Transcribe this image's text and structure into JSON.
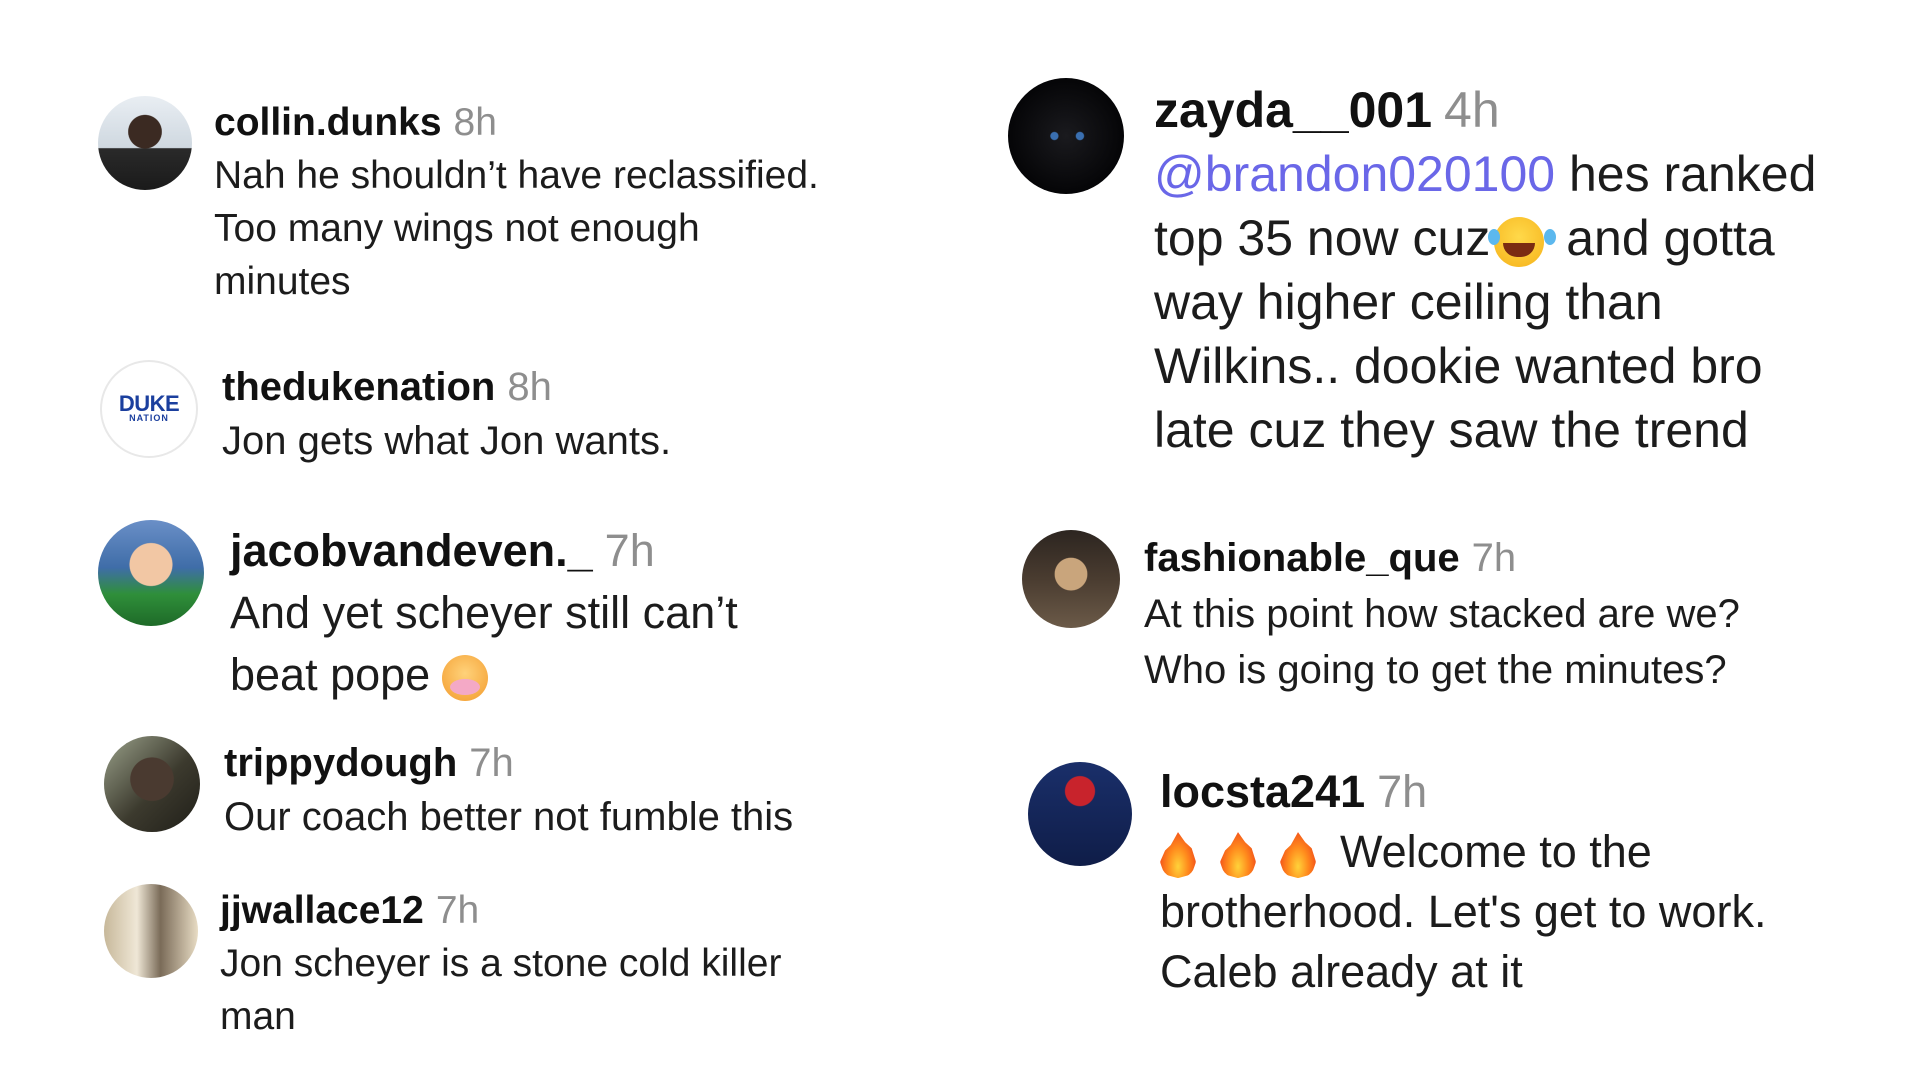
{
  "comments_left": [
    {
      "id": "collin",
      "username": "collin.dunks",
      "time": "8h",
      "lines": [
        "Nah he shouldn’t have reclassified.",
        "Too many wings not enough",
        "minutes"
      ],
      "avatar_icon": "person-photo-icon"
    },
    {
      "id": "duke",
      "username": "thedukenation",
      "time": "8h",
      "lines": [
        "Jon gets what Jon wants."
      ],
      "avatar_logo": "DUKE",
      "avatar_logo_sub": "NATION",
      "avatar_icon": "duke-logo-icon"
    },
    {
      "id": "jacob",
      "username": "jacobvandeven._",
      "time": "7h",
      "lines": [
        "And yet scheyer still can’t",
        "beat pope"
      ],
      "emoji": "nauseated-face-icon",
      "avatar_icon": "person-photo-icon"
    },
    {
      "id": "trippy",
      "username": "trippydough",
      "time": "7h",
      "lines": [
        "Our coach better not fumble this"
      ],
      "avatar_icon": "person-photo-icon"
    },
    {
      "id": "jjwallace",
      "username": "jjwallace12",
      "time": "7h",
      "lines": [
        "Jon scheyer is a stone cold killer",
        "man"
      ],
      "avatar_icon": "group-photo-icon"
    }
  ],
  "comments_right": [
    {
      "id": "zayda",
      "username": "zayda__001",
      "time": "4h",
      "mention": "@brandon020100",
      "line1_rest": " hes ranked",
      "line2_before_emoji": "top 35 now cuz",
      "line2_after_emoji": " and gotta",
      "lines_rest": [
        "way higher ceiling than",
        "Wilkins.. dookie wanted bro",
        "late cuz they saw the trend"
      ],
      "emoji": "laughing-tears-icon",
      "avatar_icon": "black-cat-icon"
    },
    {
      "id": "fashion",
      "username": "fashionable_que",
      "time": "7h",
      "lines": [
        "At this point how stacked are we?",
        "Who is going to get the minutes?"
      ],
      "avatar_icon": "person-photo-icon"
    },
    {
      "id": "locsta",
      "username": "locsta241",
      "time": "7h",
      "line1_text": "Welcome to the",
      "lines_rest": [
        "brotherhood. Let's get to work.",
        "Caleb already at it"
      ],
      "emojis": [
        "fire-icon",
        "fire-icon",
        "fire-icon"
      ],
      "avatar_icon": "blue-devils-badge-icon"
    }
  ],
  "colors": {
    "username": "#111111",
    "timestamp": "#8e8e8e",
    "mention": "#6a67e8",
    "text": "#1c1c1c",
    "background": "#ffffff"
  }
}
